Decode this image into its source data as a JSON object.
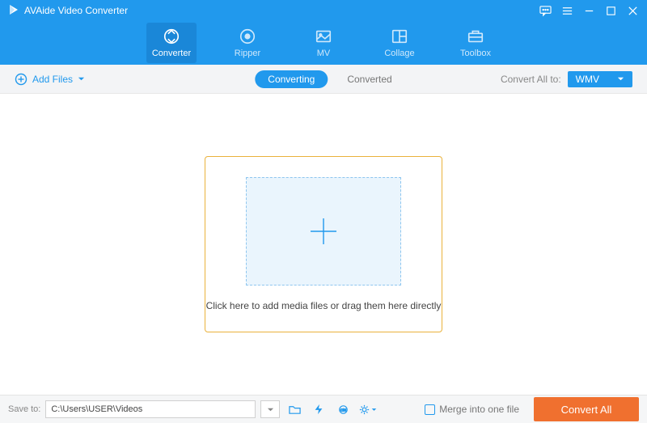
{
  "app": {
    "title": "AVAide Video Converter"
  },
  "nav": {
    "items": [
      {
        "label": "Converter"
      },
      {
        "label": "Ripper"
      },
      {
        "label": "MV"
      },
      {
        "label": "Collage"
      },
      {
        "label": "Toolbox"
      }
    ]
  },
  "subbar": {
    "add_files": "Add Files",
    "tabs": {
      "converting": "Converting",
      "converted": "Converted"
    },
    "convert_all_label": "Convert All to:",
    "format": "WMV"
  },
  "dropzone": {
    "text": "Click here to add media files or drag them here directly"
  },
  "footer": {
    "saveto_label": "Save to:",
    "path": "C:\\Users\\USER\\Videos",
    "merge_label": "Merge into one file",
    "convert_btn": "Convert All"
  }
}
